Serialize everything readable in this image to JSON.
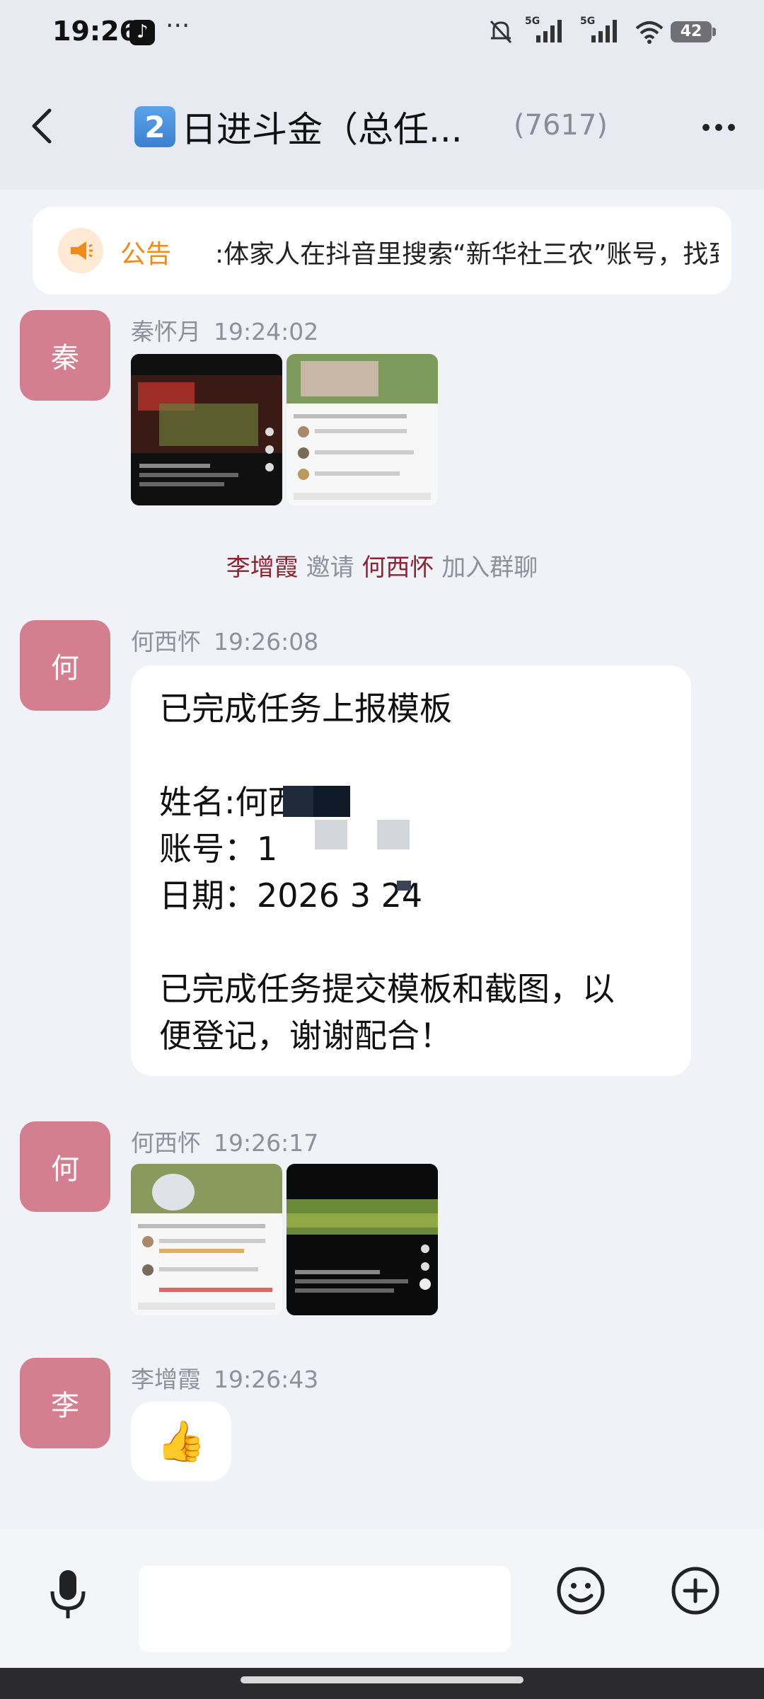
{
  "status_bar": {
    "time": "19:26",
    "overflow": "···",
    "net1": "5G",
    "net2": "5G",
    "battery": "42"
  },
  "header": {
    "keycap": "2",
    "title": "日进斗金（总任...",
    "member_count": "(7617)"
  },
  "announcement": {
    "label": "公告",
    "text": ":体家人在抖音里搜索“新华社三农”账号，找到“江"
  },
  "messages": [
    {
      "avatar": "秦",
      "sender": "秦怀月",
      "time": "19:24:02"
    },
    {
      "avatar": "何",
      "sender": "何西怀",
      "time": "19:26:08"
    },
    {
      "avatar": "何",
      "sender": "何西怀",
      "time": "19:26:17"
    },
    {
      "avatar": "李",
      "sender": "李增霞",
      "time": "19:26:43"
    }
  ],
  "system": {
    "inviter": "李增霞",
    "verb": "邀请",
    "invitee": "何西怀",
    "suffix": "加入群聊"
  },
  "report": {
    "line1": "已完成任务上报模板",
    "name_line": "姓名:何西",
    "account_line": "账号：1",
    "date_line": "日期：2026 3 24",
    "footer1": "已完成任务提交模板和截图，以",
    "footer2": "便登记，谢谢配合！"
  },
  "reaction_emoji": "👍",
  "input": {
    "placeholder": ""
  }
}
